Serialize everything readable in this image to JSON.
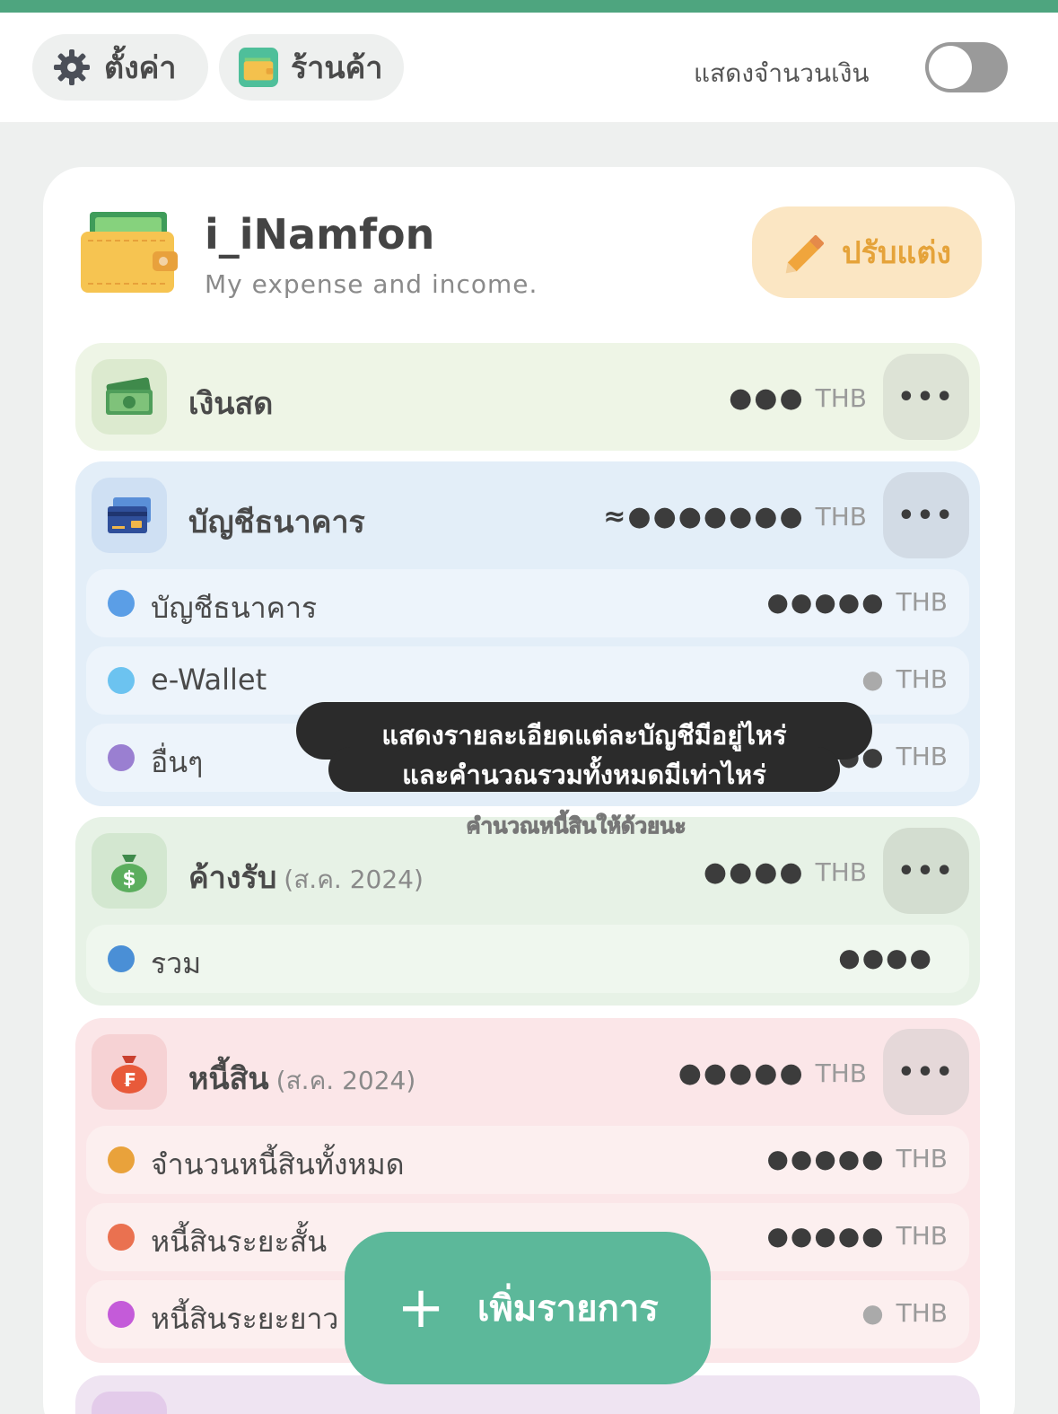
{
  "header": {
    "settings_label": "ตั้งค่า",
    "shop_label": "ร้านค้า",
    "show_amount_label": "แสดงจำนวนเงิน",
    "show_amount_on": false
  },
  "account": {
    "name": "i_iNamfon",
    "subtitle": "My expense and income.",
    "edit_label": "ปรับแต่ง"
  },
  "sections": {
    "cash": {
      "title": "เงินสด",
      "amount": "●●●",
      "currency": "THB",
      "more": "•••"
    },
    "bank": {
      "title": "บัญชีธนาคาร",
      "amount": "≈●●●●●●●",
      "currency": "THB",
      "more": "•••",
      "items": [
        {
          "label": "บัญชีธนาคาร",
          "amount": "●●●●●",
          "currency": "THB",
          "color": "#5b9ee6"
        },
        {
          "label": "e-Wallet",
          "amount": "●",
          "currency": "THB",
          "color": "#6cc3f0"
        },
        {
          "label": "อื่นๆ",
          "amount": "●●",
          "currency": "THB",
          "color": "#9a7fd1"
        }
      ]
    },
    "receivable": {
      "title": "ค้างรับ",
      "date": "(ส.ค. 2024)",
      "amount": "●●●●",
      "currency": "THB",
      "more": "•••",
      "items": [
        {
          "label": "รวม",
          "amount": "●●●●",
          "color": "#4a8fd6"
        }
      ]
    },
    "debt": {
      "title": "หนี้สิน",
      "date": "(ส.ค. 2024)",
      "amount": "●●●●●",
      "currency": "THB",
      "more": "•••",
      "items": [
        {
          "label": "จำนวนหนี้สินทั้งหมด",
          "amount": "●●●●●",
          "currency": "THB",
          "color": "#e9a23b"
        },
        {
          "label": "หนี้สินระยะสั้น",
          "amount": "●●●●●",
          "currency": "THB",
          "color": "#ea7150"
        },
        {
          "label": "หนี้สินระยะยาว",
          "amount": "●",
          "currency": "THB",
          "color": "#c45bd9"
        }
      ]
    }
  },
  "overlay": {
    "line1": "แสดงรายละเอียดแต่ละบัญชีมีอยู่ไหร่",
    "line2": "และคำนวณรวมทั้งหมดมีเท่าไหร่",
    "faint": "คำนวณหนี้สินให้ด้วยนะ"
  },
  "fab": {
    "label": "เพิ่มรายการ",
    "plus": "+"
  },
  "colors": {
    "accent": "#4ea57f",
    "fab": "#5cb89a",
    "cash_bg": "#eef5e6",
    "bank_bg": "#e3eef8",
    "receivable_bg": "#e7f2e6",
    "debt_bg": "#fbe6e8",
    "edit_bg": "#fbe6c3"
  }
}
